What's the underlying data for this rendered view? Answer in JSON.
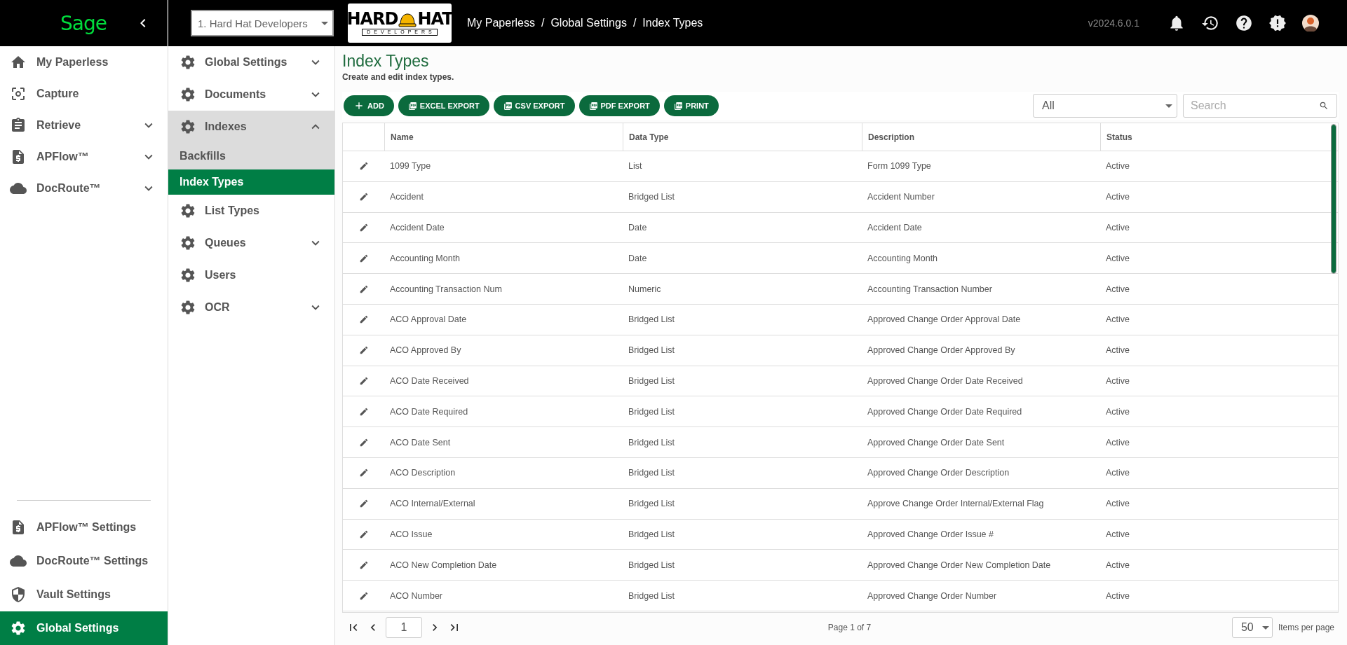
{
  "brand": {
    "logo": "Sage"
  },
  "company_select": {
    "value": "1. Hard Hat Developers"
  },
  "company_logo": {
    "word_1": "HARD",
    "word_2": "HAT",
    "tagline": "DEVELOPERS"
  },
  "breadcrumb": {
    "items": [
      "My Paperless",
      "Global Settings",
      "Index Types"
    ],
    "separator": "/"
  },
  "version": "v2024.6.0.1",
  "nav": {
    "items": [
      {
        "label": "My Paperless",
        "selected": false,
        "expandable": false
      },
      {
        "label": "Capture",
        "selected": false,
        "expandable": false
      },
      {
        "label": "Retrieve",
        "selected": false,
        "expandable": true
      },
      {
        "label": "APFlow™",
        "selected": false,
        "expandable": true
      },
      {
        "label": "DocRoute™",
        "selected": false,
        "expandable": true
      }
    ],
    "settings": [
      {
        "label": "APFlow™ Settings",
        "selected": false
      },
      {
        "label": "DocRoute™ Settings",
        "selected": false
      },
      {
        "label": "Vault Settings",
        "selected": false
      },
      {
        "label": "Global Settings",
        "selected": true
      }
    ]
  },
  "subnav": [
    {
      "label": "Global Settings",
      "expandable": true,
      "expanded": false
    },
    {
      "label": "Documents",
      "expandable": true,
      "expanded": false
    },
    {
      "label": "Indexes",
      "expandable": true,
      "expanded": true,
      "children": [
        {
          "label": "Backfills",
          "selected": false
        },
        {
          "label": "Index Types",
          "selected": true
        }
      ]
    },
    {
      "label": "List Types",
      "expandable": false,
      "expanded": false
    },
    {
      "label": "Queues",
      "expandable": true,
      "expanded": false
    },
    {
      "label": "Users",
      "expandable": false,
      "expanded": false
    },
    {
      "label": "OCR",
      "expandable": true,
      "expanded": false
    }
  ],
  "page": {
    "title": "Index Types",
    "subtitle": "Create and edit index types."
  },
  "toolbar": [
    {
      "label": "ADD",
      "kind": "add"
    },
    {
      "label": "EXCEL EXPORT",
      "kind": "export"
    },
    {
      "label": "CSV EXPORT",
      "kind": "export"
    },
    {
      "label": "PDF EXPORT",
      "kind": "export"
    },
    {
      "label": "PRINT",
      "kind": "export"
    }
  ],
  "filter": {
    "value": "All"
  },
  "search": {
    "placeholder": "Search"
  },
  "table": {
    "columns": [
      "Name",
      "Data Type",
      "Description",
      "Status"
    ],
    "rows": [
      {
        "name": "1099 Type",
        "data_type": "List",
        "description": "Form 1099 Type",
        "status": "Active"
      },
      {
        "name": "Accident",
        "data_type": "Bridged List",
        "description": "Accident Number",
        "status": "Active"
      },
      {
        "name": "Accident Date",
        "data_type": "Date",
        "description": "Accident Date",
        "status": "Active"
      },
      {
        "name": "Accounting Month",
        "data_type": "Date",
        "description": "Accounting Month",
        "status": "Active"
      },
      {
        "name": "Accounting Transaction Num",
        "data_type": "Numeric",
        "description": "Accounting Transaction Number",
        "status": "Active"
      },
      {
        "name": "ACO Approval Date",
        "data_type": "Bridged List",
        "description": "Approved Change Order Approval Date",
        "status": "Active"
      },
      {
        "name": "ACO Approved By",
        "data_type": "Bridged List",
        "description": "Approved Change Order Approved By",
        "status": "Active"
      },
      {
        "name": "ACO Date Received",
        "data_type": "Bridged List",
        "description": "Approved Change Order Date Received",
        "status": "Active"
      },
      {
        "name": "ACO Date Required",
        "data_type": "Bridged List",
        "description": "Approved Change Order Date Required",
        "status": "Active"
      },
      {
        "name": "ACO Date Sent",
        "data_type": "Bridged List",
        "description": "Approved Change Order Date Sent",
        "status": "Active"
      },
      {
        "name": "ACO Description",
        "data_type": "Bridged List",
        "description": "Approved Change Order Description",
        "status": "Active"
      },
      {
        "name": "ACO Internal/External",
        "data_type": "Bridged List",
        "description": "Approve Change Order Internal/External Flag",
        "status": "Active"
      },
      {
        "name": "ACO Issue",
        "data_type": "Bridged List",
        "description": "Approved Change Order Issue #",
        "status": "Active"
      },
      {
        "name": "ACO New Completion Date",
        "data_type": "Bridged List",
        "description": "Approved Change Order New Completion Date",
        "status": "Active"
      },
      {
        "name": "ACO Number",
        "data_type": "Bridged List",
        "description": "Approved Change Order Number",
        "status": "Active"
      }
    ]
  },
  "pagination": {
    "page": "1",
    "summary": "Page 1 of 7",
    "page_size": "50",
    "page_size_label": "Items per page"
  }
}
